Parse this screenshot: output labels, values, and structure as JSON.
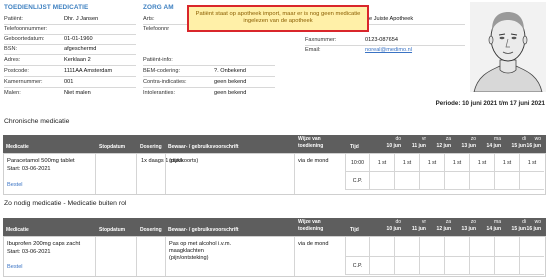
{
  "header_left_title": "TOEDIENLIJST MEDICATIE",
  "header_mid_title": "ZORG AM",
  "patient": {
    "label_patient": "Patiënt:",
    "name": "Dhr. J Jansen",
    "label_phone": "Telefoonnummer:",
    "phone": "",
    "label_dob": "Geboortedatum:",
    "dob": "01-01-1960",
    "label_bsn": "BSN:",
    "bsn": "afgeschermd",
    "label_address": "Adres:",
    "address": "Kerklaan 2",
    "label_postcode": "Postcode:",
    "postcode": "1111AA Amsterdam",
    "label_room": "Kamernummer:",
    "room": "001",
    "label_meals": "Malen:",
    "meals": "Niet malen"
  },
  "care": {
    "label_arts": "Arts:",
    "label_phone": "Telefoonnr",
    "label_patientinfo": "Patiënt-info:",
    "label_bem": "BEM-codering:",
    "bem": "?. Onbekend",
    "label_contra": "Contra-indicaties:",
    "contra": "geen bekend",
    "label_intol": "Intoleranties:",
    "intol": "geen bekend"
  },
  "pharmacy": {
    "name": "De Juiste Apotheek",
    "label_fax": "Faxnummer:",
    "fax": "0123-087654",
    "label_email": "Email:",
    "email": "noreal@medimo.nl"
  },
  "popup": {
    "text": "Patiënt staat op apotheek import, maar er is nog geen medicatie ingelezen van de apotheek"
  },
  "period": "Periode: 10 juni 2021 t/m 17 juni 2021",
  "chronic": {
    "title": "Chronische medicatie",
    "headers": {
      "medicatie": "Medicatie",
      "stopdatum": "Stopdatum",
      "dosering": "Dosering",
      "bewaar": "Bewaar- / gebruiksvoorschrift",
      "wijze_line1": "Wijze van",
      "wijze_line2": "toediening",
      "tijd": "Tijd"
    },
    "days": [
      {
        "dow": "do",
        "date": "10 jun"
      },
      {
        "dow": "vr",
        "date": "11 jun"
      },
      {
        "dow": "za",
        "date": "12 jun"
      },
      {
        "dow": "zo",
        "date": "13 jun"
      },
      {
        "dow": "ma",
        "date": "14 jun"
      },
      {
        "dow": "di",
        "date": "15 jun"
      },
      {
        "dow": "wo",
        "date": "16 jun"
      }
    ],
    "row": {
      "name": "Paracetamol 500mg tablet",
      "start": "Start: 03-06-2021",
      "order": "Bestel",
      "dosering": "1x daags 1 stuks",
      "voorschrift": "(pijn/koorts)",
      "wijze": "via de mond",
      "time": "10:00",
      "cp": "C.P.",
      "day_marks": [
        "1 st",
        "1 st",
        "1 st",
        "1 st",
        "1 st",
        "1 st",
        "1 st"
      ]
    }
  },
  "prn": {
    "title": "Zo nodig medicatie - Medicatie buiten rol",
    "headers": {
      "medicatie": "Medicatie",
      "stopdatum": "Stopdatum",
      "dosering": "Dosering",
      "bewaar": "Bewaar- / gebruiksvoorschrift",
      "wijze_line1": "Wijze van",
      "wijze_line2": "toediening",
      "tijd": "Tijd"
    },
    "days": [
      {
        "dow": "do",
        "date": "10 jun"
      },
      {
        "dow": "vr",
        "date": "11 jun"
      },
      {
        "dow": "za",
        "date": "12 jun"
      },
      {
        "dow": "zo",
        "date": "13 jun"
      },
      {
        "dow": "ma",
        "date": "14 jun"
      },
      {
        "dow": "di",
        "date": "15 jun"
      },
      {
        "dow": "wo",
        "date": "16 jun"
      }
    ],
    "row": {
      "name": "Ibuprofen 200mg caps zacht",
      "start": "Start: 03-06-2021",
      "order": "Bestel",
      "voorschrift_l1": "Pas op met alcohol i.v.m.",
      "voorschrift_l2": "maagklachten",
      "voorschrift_l3": "(pijn/ontsteking)",
      "wijze": "via de mond",
      "cp": "C.P."
    }
  }
}
